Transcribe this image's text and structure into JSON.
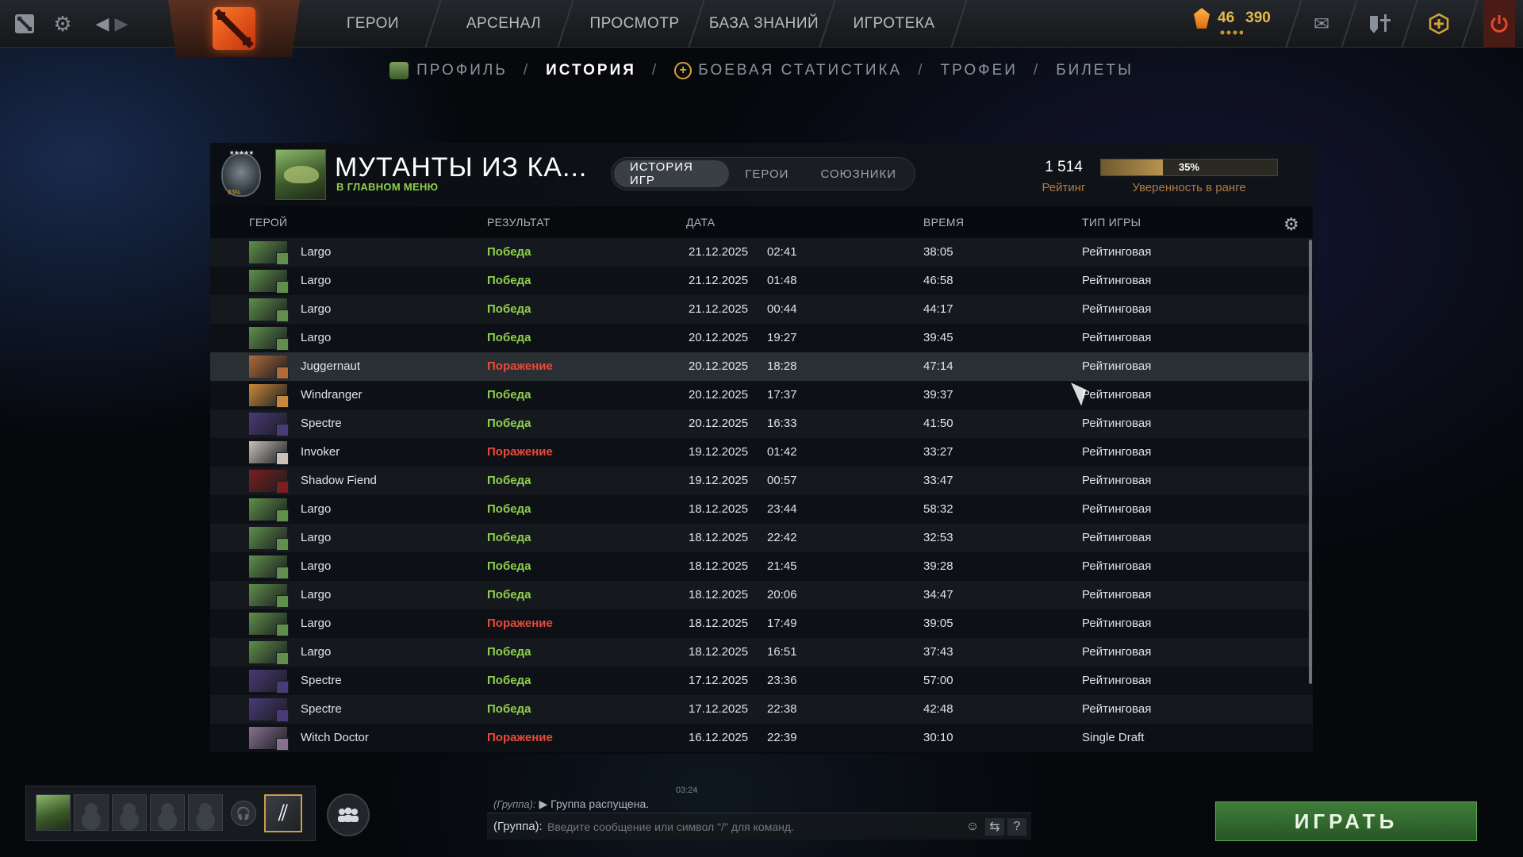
{
  "topbar": {
    "nav": [
      "ГЕРОИ",
      "АРСЕНАЛ",
      "ПРОСМОТР",
      "БАЗА ЗНАНИЙ",
      "ИГРОТЕКА"
    ],
    "currency_primary": "46",
    "currency_secondary": "390"
  },
  "subnav": {
    "items": [
      "ПРОФИЛЬ",
      "ИСТОРИЯ",
      "БОЕВАЯ СТАТИСТИКА",
      "ТРОФЕИ",
      "БИЛЕТЫ"
    ],
    "active_index": 1,
    "separator": "/"
  },
  "profile": {
    "name": "МУТАНТЫ ИЗ КА...",
    "status": "В ГЛАВНОМ МЕНЮ",
    "rank_stars": "★★★★★",
    "rank_progress": "83%",
    "rating": "1 514",
    "rating_label": "Рейтинг",
    "confidence_percent": 35,
    "confidence_text": "35%",
    "confidence_label": "Уверенность в ранге"
  },
  "tabs": [
    {
      "label": "ИСТОРИЯ ИГР",
      "active": true
    },
    {
      "label": "ГЕРОИ",
      "active": false
    },
    {
      "label": "СОЮЗНИКИ",
      "active": false
    }
  ],
  "columns": {
    "hero": "ГЕРОЙ",
    "result": "РЕЗУЛЬТАТ",
    "date": "ДАТА",
    "duration": "ВРЕМЯ",
    "mode": "ТИП ИГРЫ"
  },
  "hero_colors": {
    "Largo": "#5f8f4a",
    "Juggernaut": "#b06a3a",
    "Windranger": "#c9893a",
    "Spectre": "#4a3a78",
    "Invoker": "#c9c0b8",
    "Shadow Fiend": "#7a1e1e",
    "Witch Doctor": "#8a7090"
  },
  "matches": [
    {
      "hero": "Largo",
      "result": "Победа",
      "win": true,
      "date": "21.12.2025",
      "time": "02:41",
      "duration": "38:05",
      "mode": "Рейтинговая"
    },
    {
      "hero": "Largo",
      "result": "Победа",
      "win": true,
      "date": "21.12.2025",
      "time": "01:48",
      "duration": "46:58",
      "mode": "Рейтинговая"
    },
    {
      "hero": "Largo",
      "result": "Победа",
      "win": true,
      "date": "21.12.2025",
      "time": "00:44",
      "duration": "44:17",
      "mode": "Рейтинговая"
    },
    {
      "hero": "Largo",
      "result": "Победа",
      "win": true,
      "date": "20.12.2025",
      "time": "19:27",
      "duration": "39:45",
      "mode": "Рейтинговая"
    },
    {
      "hero": "Juggernaut",
      "result": "Поражение",
      "win": false,
      "date": "20.12.2025",
      "time": "18:28",
      "duration": "47:14",
      "mode": "Рейтинговая"
    },
    {
      "hero": "Windranger",
      "result": "Победа",
      "win": true,
      "date": "20.12.2025",
      "time": "17:37",
      "duration": "39:37",
      "mode": "Рейтинговая"
    },
    {
      "hero": "Spectre",
      "result": "Победа",
      "win": true,
      "date": "20.12.2025",
      "time": "16:33",
      "duration": "41:50",
      "mode": "Рейтинговая"
    },
    {
      "hero": "Invoker",
      "result": "Поражение",
      "win": false,
      "date": "19.12.2025",
      "time": "01:42",
      "duration": "33:27",
      "mode": "Рейтинговая"
    },
    {
      "hero": "Shadow Fiend",
      "result": "Победа",
      "win": true,
      "date": "19.12.2025",
      "time": "00:57",
      "duration": "33:47",
      "mode": "Рейтинговая"
    },
    {
      "hero": "Largo",
      "result": "Победа",
      "win": true,
      "date": "18.12.2025",
      "time": "23:44",
      "duration": "58:32",
      "mode": "Рейтинговая"
    },
    {
      "hero": "Largo",
      "result": "Победа",
      "win": true,
      "date": "18.12.2025",
      "time": "22:42",
      "duration": "32:53",
      "mode": "Рейтинговая"
    },
    {
      "hero": "Largo",
      "result": "Победа",
      "win": true,
      "date": "18.12.2025",
      "time": "21:45",
      "duration": "39:28",
      "mode": "Рейтинговая"
    },
    {
      "hero": "Largo",
      "result": "Победа",
      "win": true,
      "date": "18.12.2025",
      "time": "20:06",
      "duration": "34:47",
      "mode": "Рейтинговая"
    },
    {
      "hero": "Largo",
      "result": "Поражение",
      "win": false,
      "date": "18.12.2025",
      "time": "17:49",
      "duration": "39:05",
      "mode": "Рейтинговая"
    },
    {
      "hero": "Largo",
      "result": "Победа",
      "win": true,
      "date": "18.12.2025",
      "time": "16:51",
      "duration": "37:43",
      "mode": "Рейтинговая"
    },
    {
      "hero": "Spectre",
      "result": "Победа",
      "win": true,
      "date": "17.12.2025",
      "time": "23:36",
      "duration": "57:00",
      "mode": "Рейтинговая"
    },
    {
      "hero": "Spectre",
      "result": "Победа",
      "win": true,
      "date": "17.12.2025",
      "time": "22:38",
      "duration": "42:48",
      "mode": "Рейтинговая"
    },
    {
      "hero": "Witch Doctor",
      "result": "Поражение",
      "win": false,
      "date": "16.12.2025",
      "time": "22:39",
      "duration": "30:10",
      "mode": "Single Draft"
    }
  ],
  "highlighted_row": 4,
  "chat": {
    "time": "03:24",
    "message_channel": "(Группа):",
    "message_text": "▶ Группа распущена.",
    "input_prefix": "(Группа):",
    "placeholder": "Введите сообщение или символ \"/\" для команд."
  },
  "play_label": "ИГРАТЬ"
}
